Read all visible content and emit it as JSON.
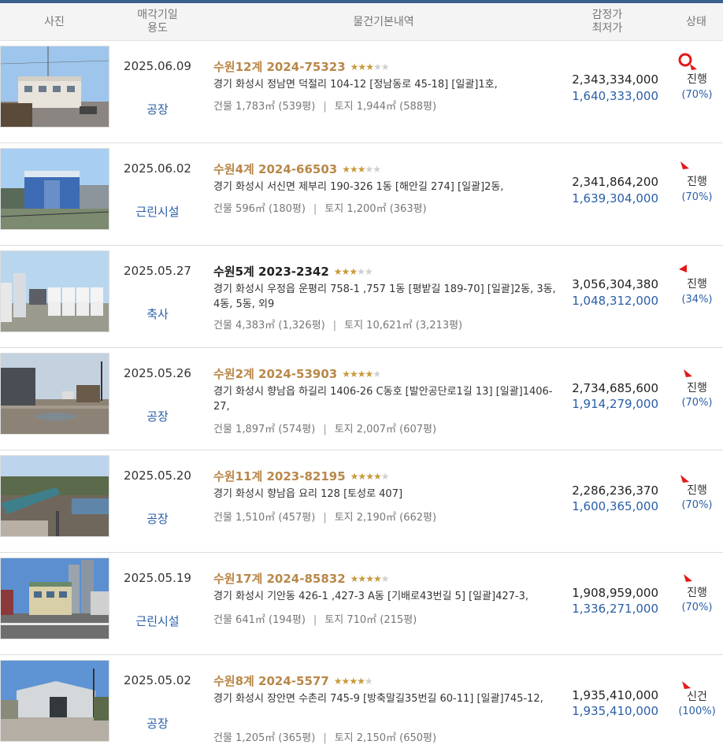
{
  "header": {
    "photo": "사진",
    "date_line1": "매각기일",
    "date_line2": "용도",
    "info": "물건기본내역",
    "price_line1": "감정가",
    "price_line2": "최저가",
    "status": "상태"
  },
  "rows": [
    {
      "date": "2025.06.09",
      "use": "공장",
      "case": "수원12계 2024-75323",
      "stars": 3,
      "address": "경기 화성시 정남면 덕절리 104-12 [정남동로 45-18]  [일괄]1호,",
      "building": "건물 1,783㎡ (539평)",
      "land": "토지 1,944㎡ (588평)",
      "appraisal": "2,343,334,000",
      "minimum": "1,640,333,000",
      "status": "진행",
      "percent": "(70%)"
    },
    {
      "date": "2025.06.02",
      "use": "근린시설",
      "case": "수원4계 2024-66503",
      "stars": 3,
      "address": "경기 화성시 서신면 제부리 190-326 1동 [해안길 274]  [일괄]2동,",
      "building": "건물 596㎡ (180평)",
      "land": "토지 1,200㎡ (363평)",
      "appraisal": "2,341,864,200",
      "minimum": "1,639,304,000",
      "status": "진행",
      "percent": "(70%)"
    },
    {
      "date": "2025.05.27",
      "use": "축사",
      "case": "수원5계 2023-2342",
      "stars": 3,
      "address": "경기 화성시 우정읍 운평리 758-1 ,757 1동 [평밭길 189-70]  [일괄]2동, 3동, 4동, 5동, 외9",
      "building": "건물 4,383㎡ (1,326평)",
      "land": "토지 10,621㎡ (3,213평)",
      "appraisal": "3,056,304,380",
      "minimum": "1,048,312,000",
      "status": "진행",
      "percent": "(34%)"
    },
    {
      "date": "2025.05.26",
      "use": "공장",
      "case": "수원2계 2024-53903",
      "stars": 4,
      "address": "경기 화성시 향남읍 하길리 1406-26 C동호 [발안공단로1길 13]  [일괄]1406-27,",
      "building": "건물 1,897㎡ (574평)",
      "land": "토지 2,007㎡ (607평)",
      "appraisal": "2,734,685,600",
      "minimum": "1,914,279,000",
      "status": "진행",
      "percent": "(70%)"
    },
    {
      "date": "2025.05.20",
      "use": "공장",
      "case": "수원11계 2023-82195",
      "stars": 4,
      "address": "경기 화성시 향남읍 요리 128 [토성로 407]",
      "building": "건물 1,510㎡ (457평)",
      "land": "토지 2,190㎡ (662평)",
      "appraisal": "2,286,236,370",
      "minimum": "1,600,365,000",
      "status": "진행",
      "percent": "(70%)"
    },
    {
      "date": "2025.05.19",
      "use": "근린시설",
      "case": "수원17계 2024-85832",
      "stars": 4,
      "address": "경기 화성시 기안동 426-1 ,427-3 A동 [기배로43번길 5]  [일괄]427-3,",
      "building": "건물 641㎡ (194평)",
      "land": "토지 710㎡ (215평)",
      "appraisal": "1,908,959,000",
      "minimum": "1,336,271,000",
      "status": "진행",
      "percent": "(70%)"
    },
    {
      "date": "2025.05.02",
      "use": "공장",
      "case": "수원8계 2024-5577",
      "stars": 4,
      "address": "경기 화성시 장안면 수촌리 745-9 [방축말길35번길 60-11]  [일괄]745-12,",
      "building": "건물 1,205㎡ (365평)",
      "land": "토지 2,150㎡ (650평)",
      "appraisal": "1,935,410,000",
      "minimum": "1,935,410,000",
      "status": "신건",
      "percent": "(100%)"
    }
  ],
  "colors": {
    "header_bar": "#3b5f8f",
    "case_gold": "#b8884a",
    "blue": "#2a5ea8",
    "star_on": "#c99a3c",
    "star_off": "#cfcfcf",
    "marker_red": "#e31919"
  },
  "icons": {
    "photo": "property-photo",
    "marker": "red-arrow-marker",
    "circle": "red-circle-marker"
  }
}
